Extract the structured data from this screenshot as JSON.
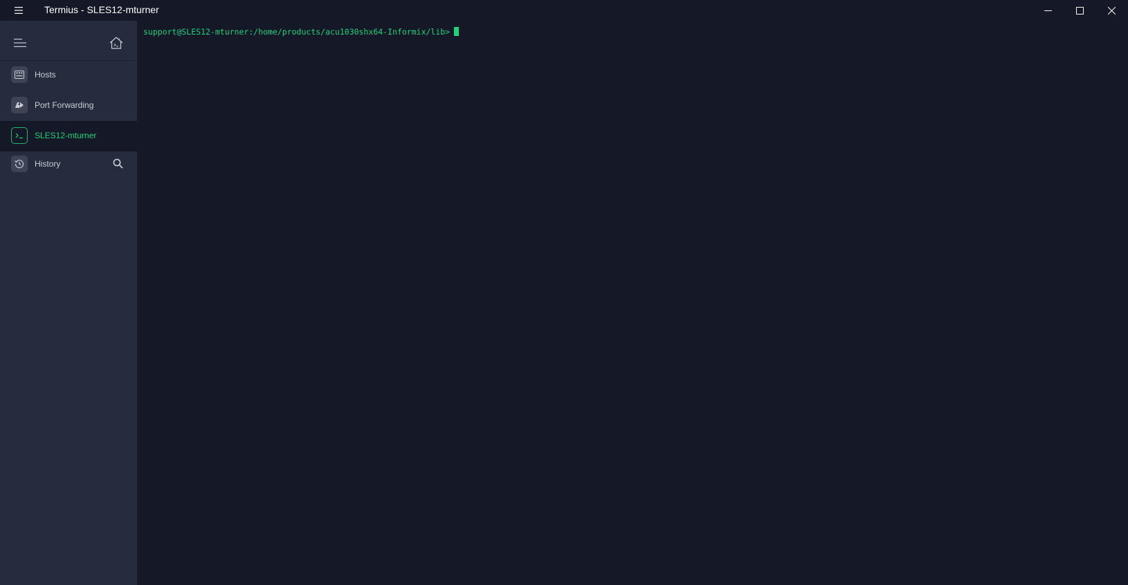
{
  "window": {
    "title": "Termius - SLES12-mturner"
  },
  "sidebar": {
    "items": [
      {
        "label": "Hosts",
        "icon": "hosts-icon"
      },
      {
        "label": "Port Forwarding",
        "icon": "port-forwarding-icon"
      },
      {
        "label": "SLES12-mturner",
        "icon": "terminal-icon",
        "active": true
      },
      {
        "label": "History",
        "icon": "history-icon"
      }
    ]
  },
  "terminal": {
    "prompt": "support@SLES12-mturner:/home/products/acu1030shx64-Informix/lib>"
  },
  "colors": {
    "background": "#141827",
    "sidebar": "#262c3d",
    "accent": "#1fd37a"
  }
}
